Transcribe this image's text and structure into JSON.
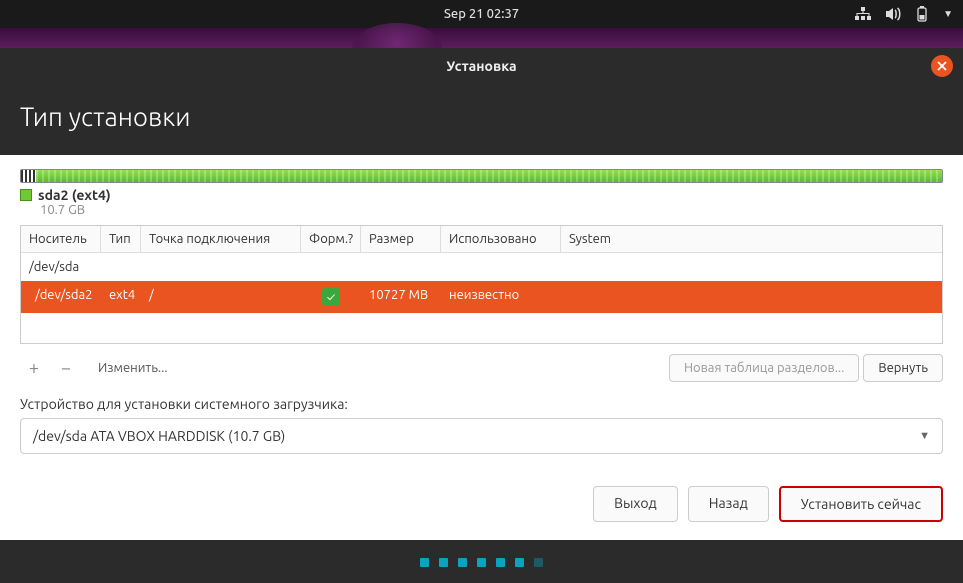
{
  "topbar": {
    "datetime": "Sep 21  02:37"
  },
  "window": {
    "title": "Установка"
  },
  "header": {
    "title": "Тип установки"
  },
  "partition_overview": {
    "name": "sda2 (ext4)",
    "size": "10.7 GB"
  },
  "table": {
    "headers": {
      "device": "Носитель",
      "type": "Тип",
      "mount": "Точка подключения",
      "format": "Форм.?",
      "size": "Размер",
      "used": "Использовано",
      "system": "System"
    },
    "rows": [
      {
        "device": "/dev/sda",
        "type": "",
        "mount": "",
        "format": false,
        "size": "",
        "used": "",
        "system": "",
        "parent": true,
        "selected": false
      },
      {
        "device": "/dev/sda2",
        "type": "ext4",
        "mount": "/",
        "format": true,
        "size": "10727 MB",
        "used": "неизвестно",
        "system": "",
        "parent": false,
        "selected": true
      }
    ]
  },
  "toolbar": {
    "add": "+",
    "remove": "−",
    "change": "Изменить...",
    "new_table": "Новая таблица разделов...",
    "revert": "Вернуть"
  },
  "bootloader": {
    "label": "Устройство для установки системного загрузчика:",
    "value": "/dev/sda   ATA VBOX HARDDISK (10.7 GB)"
  },
  "nav": {
    "quit": "Выход",
    "back": "Назад",
    "install": "Установить сейчас"
  }
}
